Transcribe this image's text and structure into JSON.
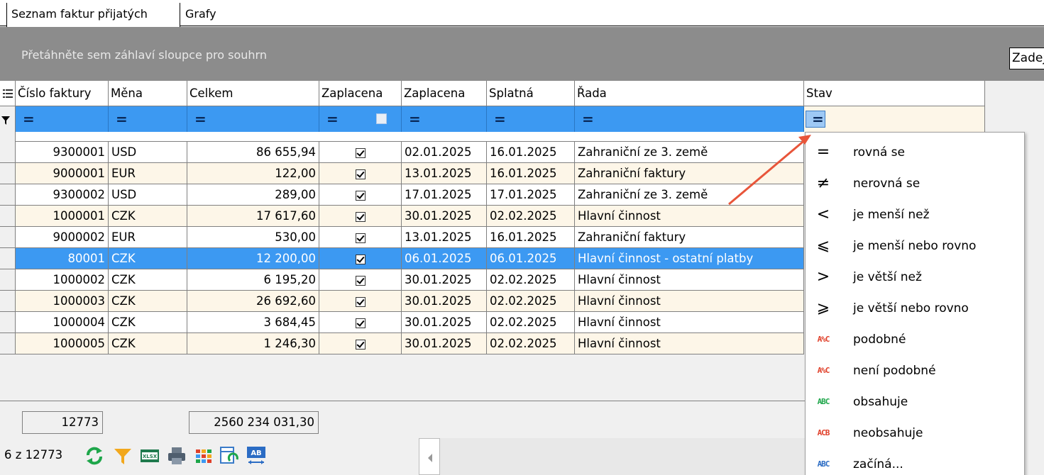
{
  "tabs": [
    "Seznam faktur přijatých",
    "Grafy"
  ],
  "group_panel_hint": "Přetáhněte sem záhlaví sloupce pro souhrn",
  "search_placeholder": "Zadej",
  "columns": [
    "Číslo faktury",
    "Měna",
    "Celkem",
    "Zaplacena",
    "Zaplacena",
    "Splatná",
    "Řada",
    "Stav"
  ],
  "filter_operator_symbol": "=",
  "rows": [
    {
      "cislo": "9300001",
      "mena": "USD",
      "celkem": "86 655,94",
      "zaplacena_datum": "02.01.2025",
      "splatna": "16.01.2025",
      "rada": "Zahraniční ze 3. země",
      "selected": false
    },
    {
      "cislo": "9000001",
      "mena": "EUR",
      "celkem": "122,00",
      "zaplacena_datum": "13.01.2025",
      "splatna": "16.01.2025",
      "rada": "Zahraniční faktury",
      "selected": false
    },
    {
      "cislo": "9300002",
      "mena": "USD",
      "celkem": "289,00",
      "zaplacena_datum": "17.01.2025",
      "splatna": "17.01.2025",
      "rada": "Zahraniční ze 3. země",
      "selected": false
    },
    {
      "cislo": "1000001",
      "mena": "CZK",
      "celkem": "17 617,60",
      "zaplacena_datum": "30.01.2025",
      "splatna": "02.02.2025",
      "rada": "Hlavní činnost",
      "selected": false
    },
    {
      "cislo": "9000002",
      "mena": "EUR",
      "celkem": "530,00",
      "zaplacena_datum": "13.01.2025",
      "splatna": "16.01.2025",
      "rada": "Zahraniční faktury",
      "selected": false
    },
    {
      "cislo": "80001",
      "mena": "CZK",
      "celkem": "12 200,00",
      "zaplacena_datum": "06.01.2025",
      "splatna": "06.01.2025",
      "rada": "Hlavní činnost - ostatní platby",
      "selected": true
    },
    {
      "cislo": "1000002",
      "mena": "CZK",
      "celkem": "6 195,20",
      "zaplacena_datum": "30.01.2025",
      "splatna": "02.02.2025",
      "rada": "Hlavní činnost",
      "selected": false
    },
    {
      "cislo": "1000003",
      "mena": "CZK",
      "celkem": "26 692,60",
      "zaplacena_datum": "30.01.2025",
      "splatna": "02.02.2025",
      "rada": "Hlavní činnost",
      "selected": false
    },
    {
      "cislo": "1000004",
      "mena": "CZK",
      "celkem": "3 684,45",
      "zaplacena_datum": "30.01.2025",
      "splatna": "02.02.2025",
      "rada": "Hlavní činnost",
      "selected": false
    },
    {
      "cislo": "1000005",
      "mena": "CZK",
      "celkem": "1 246,30",
      "zaplacena_datum": "30.01.2025",
      "splatna": "02.02.2025",
      "rada": "Hlavní činnost",
      "selected": false
    }
  ],
  "totals": {
    "count": "12773",
    "sum": "2560 234 031,30"
  },
  "navigator": {
    "record_text": "6 z 12773"
  },
  "toolbar_icons": [
    "refresh-icon",
    "filter-icon",
    "xlsx-export-icon",
    "print-icon",
    "column-chooser-icon",
    "layout-refresh-icon",
    "autofit-columns-icon"
  ],
  "filter_menu": [
    {
      "icon": "=",
      "label": "rovná se"
    },
    {
      "icon": "≠",
      "label": "nerovná se"
    },
    {
      "icon": "<",
      "label": "je menší než"
    },
    {
      "icon": "⩽",
      "label": "je menší nebo rovno"
    },
    {
      "icon": ">",
      "label": "je větší než"
    },
    {
      "icon": "⩾",
      "label": "je větší nebo rovno"
    },
    {
      "icon": "A%C",
      "label": "podobné"
    },
    {
      "icon": "A%C",
      "label": "není podobné"
    },
    {
      "icon": "ABC",
      "label": "obsahuje"
    },
    {
      "icon": "ACB",
      "label": "neobsahuje"
    },
    {
      "icon": "ABC",
      "label": "začíná..."
    }
  ],
  "colors": {
    "selection": "#3c99f2",
    "row_alt": "#fdf6e8",
    "arrow": "#e8553a"
  }
}
